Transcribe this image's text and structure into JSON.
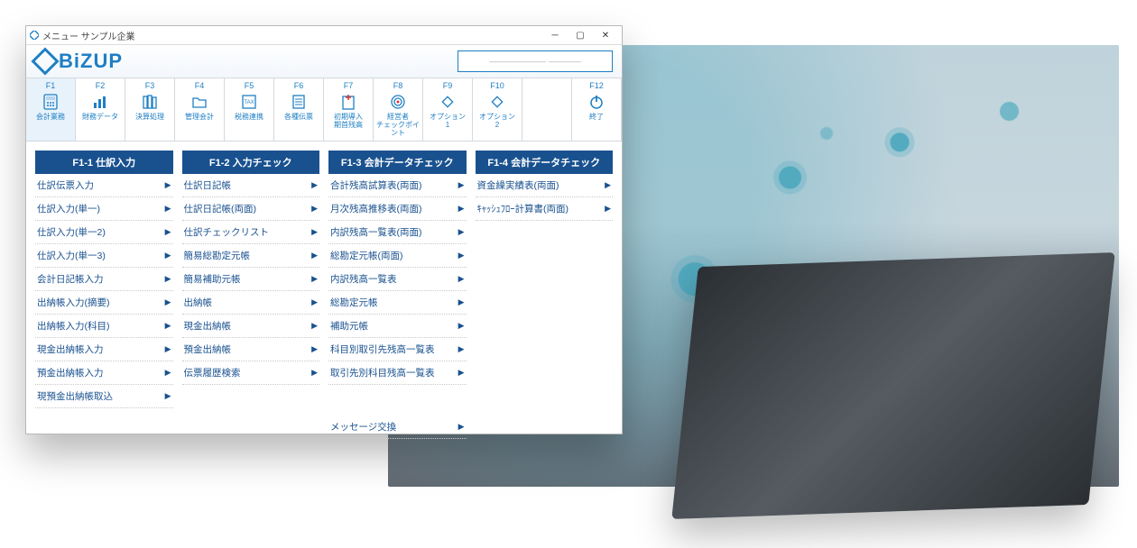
{
  "window": {
    "title": "メニュー サンプル企業"
  },
  "brand": {
    "name_before_i": "B",
    "name_i": "i",
    "name_after": "ZUP"
  },
  "userbox": "———————   ————",
  "fkeys": [
    {
      "key": "F1",
      "label": "会計業務",
      "icon": "calc",
      "active": true
    },
    {
      "key": "F2",
      "label": "財務データ",
      "icon": "bars"
    },
    {
      "key": "F3",
      "label": "決算処理",
      "icon": "books"
    },
    {
      "key": "F4",
      "label": "管理会計",
      "icon": "folder"
    },
    {
      "key": "F5",
      "label": "税務連携",
      "icon": "tax"
    },
    {
      "key": "F6",
      "label": "各種伝票",
      "icon": "slip"
    },
    {
      "key": "F7",
      "label": "初期導入\n期首残高",
      "icon": "plus"
    },
    {
      "key": "F8",
      "label": "経営者\nチェックポイント",
      "icon": "target"
    },
    {
      "key": "F9",
      "label": "オプション\n1",
      "icon": "diamond"
    },
    {
      "key": "F10",
      "label": "オプション\n2",
      "icon": "diamond"
    },
    {
      "key": "F12",
      "label": "終了",
      "icon": "power"
    }
  ],
  "columns": [
    {
      "header": "F1-1 仕訳入力",
      "items": [
        "仕訳伝票入力",
        "仕訳入力(単一)",
        "仕訳入力(単一2)",
        "仕訳入力(単一3)",
        "会計日記帳入力",
        "出納帳入力(摘要)",
        "出納帳入力(科目)",
        "現金出納帳入力",
        "預金出納帳入力",
        "現預金出納帳取込"
      ]
    },
    {
      "header": "F1-2 入力チェック",
      "items": [
        "仕訳日記帳",
        "仕訳日記帳(両面)",
        "仕訳チェックリスト",
        "簡易総勘定元帳",
        "簡易補助元帳",
        "出納帳",
        "現金出納帳",
        "預金出納帳",
        "伝票履歴検索"
      ]
    },
    {
      "header": "F1-3 会計データチェック",
      "items": [
        "合計残高試算表(両面)",
        "月次残高推移表(両面)",
        "内訳残高一覧表(両面)",
        "総勘定元帳(両面)",
        "内訳残高一覧表",
        "総勘定元帳",
        "補助元帳",
        "科目別取引先残高一覧表",
        "取引先別科目残高一覧表"
      ],
      "footer": [
        "メッセージ交換"
      ]
    },
    {
      "header": "F1-4 会計データチェック",
      "items": [
        "資金繰実績表(両面)",
        "ｷｬｯｼｭﾌﾛｰ計算書(両面)"
      ]
    }
  ]
}
